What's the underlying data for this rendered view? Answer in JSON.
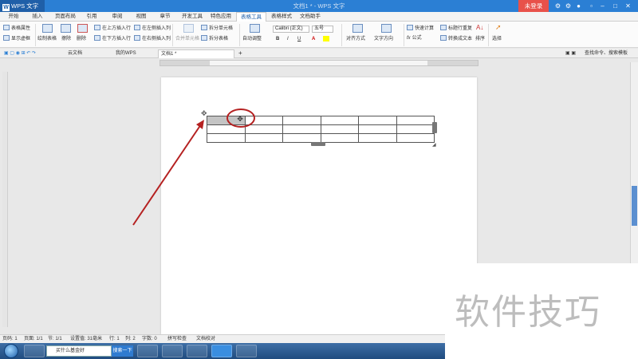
{
  "titlebar": {
    "app_menu": "WPS 文字",
    "window_title": "文档1 * - WPS 文字",
    "login_button": "未登录"
  },
  "tabs": [
    "开始",
    "插入",
    "页面布局",
    "引用",
    "审阅",
    "视图",
    "章节",
    "开发工具",
    "特色应用",
    "表格工具",
    "表格样式",
    "文档助手"
  ],
  "active_tab": "表格工具",
  "ribbon": {
    "table_properties": "表格属性",
    "show_gridlines": "显示虚框",
    "draw_table": "绘制表格",
    "erase": "擦除",
    "delete": "删除",
    "insert_row_above": "在上方插入行",
    "insert_row_below": "在下方插入行",
    "insert_col_left": "在左侧插入列",
    "insert_col_right": "在右侧插入列",
    "merge_cells": "合并单元格",
    "split_cells": "拆分单元格",
    "split_table": "拆分表格",
    "auto_fit": "自动调整",
    "font_name": "Calibri (正文)",
    "font_size": "五号",
    "bold": "B",
    "italic": "I",
    "underline": "U",
    "font_color": "A",
    "alignment": "对齐方式",
    "text_direction": "文字方向",
    "quick_calc": "快速计算",
    "formula": "公式",
    "header_repeat": "标题行重复",
    "convert_to_text": "转换成文本",
    "sort": "排序",
    "select": "选择"
  },
  "doc_tabs": [
    "云文档",
    "我的WPS",
    "文档1 *"
  ],
  "active_doc_tab": "文档1 *",
  "add_tab": "+",
  "command_search": "查找命令、搜索模板",
  "table": {
    "rows": 3,
    "cols": 6,
    "selected_cells": [
      [
        0,
        0
      ]
    ]
  },
  "statusbar": {
    "page_num": "页码: 1",
    "pages": "页面: 1/1",
    "section": "节: 1/1",
    "position": "设置值: 31毫米",
    "line": "行: 1",
    "col": "列: 2",
    "words": "字数: 0",
    "spell_check": "拼写检查",
    "doc_check": "文档校对"
  },
  "taskbar": {
    "search_text": "买什么基金好",
    "search_button": "搜索一下"
  },
  "watermark": "软件技巧",
  "colors": {
    "titlebar": "#2b7fd4",
    "login": "#e8514a",
    "annotation": "#b52121",
    "selected_cell": "#c4c4c4"
  }
}
